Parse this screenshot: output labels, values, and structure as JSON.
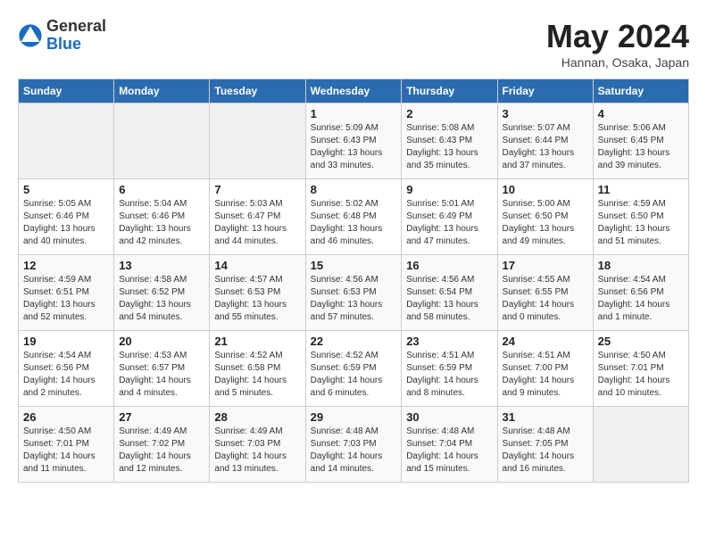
{
  "header": {
    "logo_general": "General",
    "logo_blue": "Blue",
    "month_title": "May 2024",
    "location": "Hannan, Osaka, Japan"
  },
  "days_of_week": [
    "Sunday",
    "Monday",
    "Tuesday",
    "Wednesday",
    "Thursday",
    "Friday",
    "Saturday"
  ],
  "weeks": [
    [
      {
        "day": "",
        "info": ""
      },
      {
        "day": "",
        "info": ""
      },
      {
        "day": "",
        "info": ""
      },
      {
        "day": "1",
        "info": "Sunrise: 5:09 AM\nSunset: 6:43 PM\nDaylight: 13 hours\nand 33 minutes."
      },
      {
        "day": "2",
        "info": "Sunrise: 5:08 AM\nSunset: 6:43 PM\nDaylight: 13 hours\nand 35 minutes."
      },
      {
        "day": "3",
        "info": "Sunrise: 5:07 AM\nSunset: 6:44 PM\nDaylight: 13 hours\nand 37 minutes."
      },
      {
        "day": "4",
        "info": "Sunrise: 5:06 AM\nSunset: 6:45 PM\nDaylight: 13 hours\nand 39 minutes."
      }
    ],
    [
      {
        "day": "5",
        "info": "Sunrise: 5:05 AM\nSunset: 6:46 PM\nDaylight: 13 hours\nand 40 minutes."
      },
      {
        "day": "6",
        "info": "Sunrise: 5:04 AM\nSunset: 6:46 PM\nDaylight: 13 hours\nand 42 minutes."
      },
      {
        "day": "7",
        "info": "Sunrise: 5:03 AM\nSunset: 6:47 PM\nDaylight: 13 hours\nand 44 minutes."
      },
      {
        "day": "8",
        "info": "Sunrise: 5:02 AM\nSunset: 6:48 PM\nDaylight: 13 hours\nand 46 minutes."
      },
      {
        "day": "9",
        "info": "Sunrise: 5:01 AM\nSunset: 6:49 PM\nDaylight: 13 hours\nand 47 minutes."
      },
      {
        "day": "10",
        "info": "Sunrise: 5:00 AM\nSunset: 6:50 PM\nDaylight: 13 hours\nand 49 minutes."
      },
      {
        "day": "11",
        "info": "Sunrise: 4:59 AM\nSunset: 6:50 PM\nDaylight: 13 hours\nand 51 minutes."
      }
    ],
    [
      {
        "day": "12",
        "info": "Sunrise: 4:59 AM\nSunset: 6:51 PM\nDaylight: 13 hours\nand 52 minutes."
      },
      {
        "day": "13",
        "info": "Sunrise: 4:58 AM\nSunset: 6:52 PM\nDaylight: 13 hours\nand 54 minutes."
      },
      {
        "day": "14",
        "info": "Sunrise: 4:57 AM\nSunset: 6:53 PM\nDaylight: 13 hours\nand 55 minutes."
      },
      {
        "day": "15",
        "info": "Sunrise: 4:56 AM\nSunset: 6:53 PM\nDaylight: 13 hours\nand 57 minutes."
      },
      {
        "day": "16",
        "info": "Sunrise: 4:56 AM\nSunset: 6:54 PM\nDaylight: 13 hours\nand 58 minutes."
      },
      {
        "day": "17",
        "info": "Sunrise: 4:55 AM\nSunset: 6:55 PM\nDaylight: 14 hours\nand 0 minutes."
      },
      {
        "day": "18",
        "info": "Sunrise: 4:54 AM\nSunset: 6:56 PM\nDaylight: 14 hours\nand 1 minute."
      }
    ],
    [
      {
        "day": "19",
        "info": "Sunrise: 4:54 AM\nSunset: 6:56 PM\nDaylight: 14 hours\nand 2 minutes."
      },
      {
        "day": "20",
        "info": "Sunrise: 4:53 AM\nSunset: 6:57 PM\nDaylight: 14 hours\nand 4 minutes."
      },
      {
        "day": "21",
        "info": "Sunrise: 4:52 AM\nSunset: 6:58 PM\nDaylight: 14 hours\nand 5 minutes."
      },
      {
        "day": "22",
        "info": "Sunrise: 4:52 AM\nSunset: 6:59 PM\nDaylight: 14 hours\nand 6 minutes."
      },
      {
        "day": "23",
        "info": "Sunrise: 4:51 AM\nSunset: 6:59 PM\nDaylight: 14 hours\nand 8 minutes."
      },
      {
        "day": "24",
        "info": "Sunrise: 4:51 AM\nSunset: 7:00 PM\nDaylight: 14 hours\nand 9 minutes."
      },
      {
        "day": "25",
        "info": "Sunrise: 4:50 AM\nSunset: 7:01 PM\nDaylight: 14 hours\nand 10 minutes."
      }
    ],
    [
      {
        "day": "26",
        "info": "Sunrise: 4:50 AM\nSunset: 7:01 PM\nDaylight: 14 hours\nand 11 minutes."
      },
      {
        "day": "27",
        "info": "Sunrise: 4:49 AM\nSunset: 7:02 PM\nDaylight: 14 hours\nand 12 minutes."
      },
      {
        "day": "28",
        "info": "Sunrise: 4:49 AM\nSunset: 7:03 PM\nDaylight: 14 hours\nand 13 minutes."
      },
      {
        "day": "29",
        "info": "Sunrise: 4:48 AM\nSunset: 7:03 PM\nDaylight: 14 hours\nand 14 minutes."
      },
      {
        "day": "30",
        "info": "Sunrise: 4:48 AM\nSunset: 7:04 PM\nDaylight: 14 hours\nand 15 minutes."
      },
      {
        "day": "31",
        "info": "Sunrise: 4:48 AM\nSunset: 7:05 PM\nDaylight: 14 hours\nand 16 minutes."
      },
      {
        "day": "",
        "info": ""
      }
    ]
  ]
}
